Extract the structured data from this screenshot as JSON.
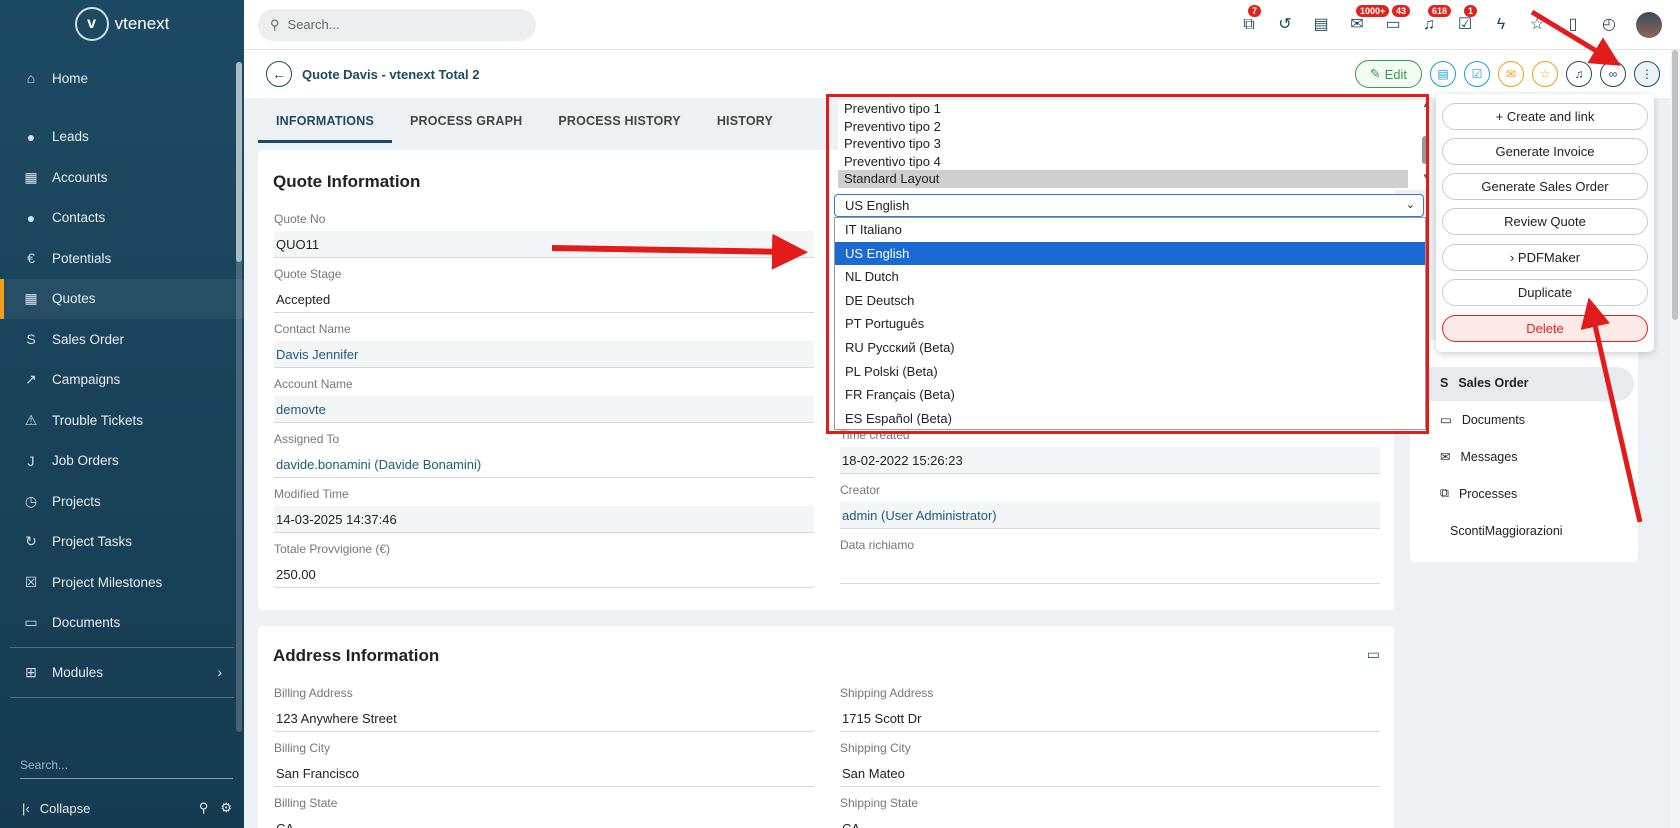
{
  "app": {
    "name": "vtenext"
  },
  "search": {
    "placeholder": "Search..."
  },
  "sidebar": {
    "items": [
      {
        "label": "Home",
        "icon": "home-icon"
      },
      {
        "label": "Leads",
        "icon": "person-icon"
      },
      {
        "label": "Accounts",
        "icon": "building-icon"
      },
      {
        "label": "Contacts",
        "icon": "person-icon"
      },
      {
        "label": "Potentials",
        "icon": "euro-icon"
      },
      {
        "label": "Quotes",
        "icon": "calculator-icon"
      },
      {
        "label": "Sales Order",
        "icon": "s-icon"
      },
      {
        "label": "Campaigns",
        "icon": "trend-icon"
      },
      {
        "label": "Trouble Tickets",
        "icon": "warning-icon"
      },
      {
        "label": "Job Orders",
        "icon": "j-icon"
      },
      {
        "label": "Projects",
        "icon": "clock-icon"
      },
      {
        "label": "Project Tasks",
        "icon": "refresh-icon"
      },
      {
        "label": "Project Milestones",
        "icon": "calendar-x-icon"
      },
      {
        "label": "Documents",
        "icon": "folder-icon"
      }
    ],
    "modules_label": "Modules",
    "search_placeholder": "Search...",
    "collapse_label": "Collapse"
  },
  "topbar": {
    "badges": [
      "7",
      "1000+",
      "43",
      "618",
      "1"
    ]
  },
  "header": {
    "title": "Quote Davis - vtenext Total 2",
    "edit_label": "Edit"
  },
  "tabs": [
    "INFORMATIONS",
    "PROCESS GRAPH",
    "PROCESS HISTORY",
    "HISTORY"
  ],
  "quote_info": {
    "title": "Quote Information",
    "fields": [
      {
        "label": "Quote No",
        "value": "QUO11"
      },
      {
        "label": "Quote Stage",
        "value": "Accepted"
      },
      {
        "label": "Contact Name",
        "value": "Davis Jennifer"
      },
      {
        "label": "Account Name",
        "value": "demovte"
      },
      {
        "label": "Assigned To",
        "value": "davide.bonamini (Davide Bonamini)"
      },
      {
        "label": "Modified Time",
        "value": "14-03-2025 14:37:46"
      },
      {
        "label": "Totale Provvigione (€)",
        "value": "250.00"
      }
    ],
    "right_fields": [
      {
        "label": "Time created",
        "value": "18-02-2022 15:26:23"
      },
      {
        "label": "Creator",
        "value": "admin (User Administrator)"
      },
      {
        "label": "Data richiamo",
        "value": ""
      }
    ]
  },
  "address_info": {
    "title": "Address Information",
    "fields": [
      {
        "label": "Billing Address",
        "value": "123 Anywhere Street"
      },
      {
        "label": "Billing City",
        "value": "San Francisco"
      },
      {
        "label": "Billing State",
        "value": "CA"
      }
    ],
    "right_fields": [
      {
        "label": "Shipping Address",
        "value": "1715 Scott Dr"
      },
      {
        "label": "Shipping City",
        "value": "San Mateo"
      },
      {
        "label": "Shipping State",
        "value": "CA"
      }
    ]
  },
  "layout_list": {
    "items": [
      "Preventivo tipo 1",
      "Preventivo tipo 2",
      "Preventivo tipo 3",
      "Preventivo tipo 4",
      "Standard Layout"
    ],
    "selected": "Standard Layout"
  },
  "language_select": {
    "value": "US English",
    "options": [
      "IT Italiano",
      "US English",
      "NL Dutch",
      "DE Deutsch",
      "PT Português",
      "RU Русский (Beta)",
      "PL Polski (Beta)",
      "FR Français (Beta)",
      "ES Español (Beta)"
    ]
  },
  "more_menu": {
    "items": [
      "+ Create and link",
      "Generate Invoice",
      "Generate Sales Order",
      "Review Quote",
      "› PDFMaker",
      "Duplicate",
      "Delete"
    ]
  },
  "related_panel": {
    "items": [
      "Sales Order",
      "Documents",
      "Messages",
      "Processes",
      "ScontiMaggiorazioni"
    ]
  },
  "colors": {
    "sidebar": "#1d4a63",
    "accent": "#f3a11a",
    "highlight": "#1a6ad1",
    "annotation": "#e21b1b"
  }
}
